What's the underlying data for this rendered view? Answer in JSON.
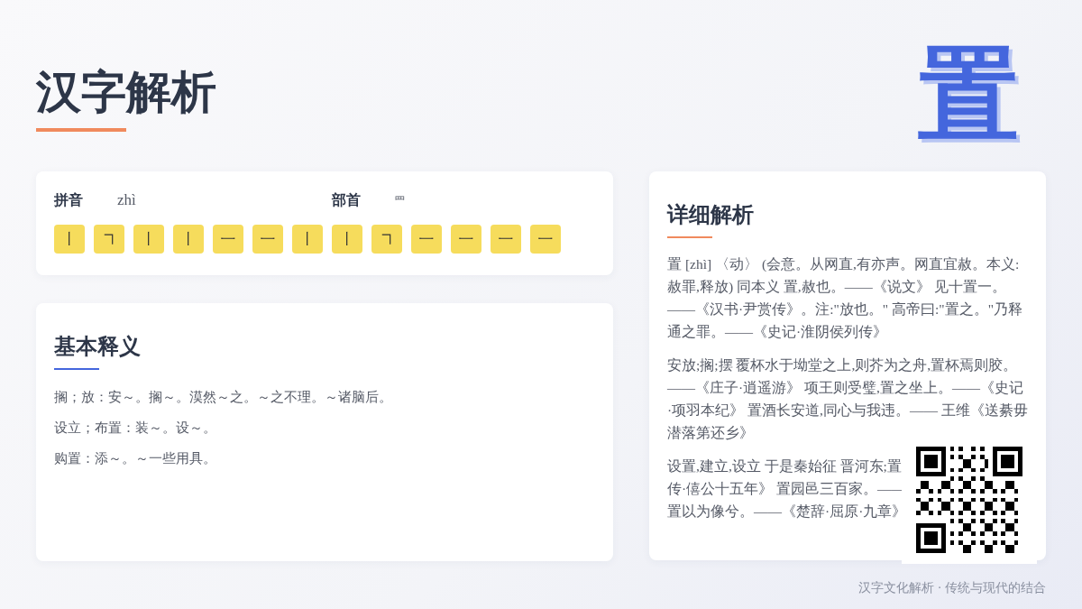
{
  "title": "汉字解析",
  "character": "置",
  "info": {
    "pinyin_label": "拼音",
    "pinyin": "zhì",
    "radical_label": "部首",
    "radical": "罒",
    "strokes": [
      "㇑",
      "㇕",
      "㇑",
      "㇑",
      "㇐",
      "㇐",
      "㇑",
      "㇑",
      "㇕",
      "㇐",
      "㇐",
      "㇐",
      "㇐"
    ]
  },
  "basic": {
    "heading": "基本释义",
    "items": [
      "搁；放：安～。搁～。漠然～之。～之不理。～诸脑后。",
      "设立；布置：装～。设～。",
      "购置：添～。～一些用具。"
    ]
  },
  "detail": {
    "heading": "详细解析",
    "paragraphs": [
      {
        "lines": [
          "置 [zhì] 〈动〉 (会意。从网直,有亦声。网直宜赦。本义:赦罪,释放) 同本义 置,赦也。——《说文》 见十置一。——《汉书·尹赏传》。注:\"放也。\" 高帝曰:\"置之。\"乃释通之罪。——《史记·淮阴侯列传》"
        ]
      },
      {
        "lines": [
          "安放;搁;摆 覆杯水于坳堂之上,则芥为之舟,置杯焉则胶。——《庄子·逍遥游》 项王则受璧,置之坐上。——《史记·项羽本纪》 置酒长安道,同心与我违。—— 王维《送綦毋潜落第还乡》"
        ]
      },
      {
        "lines": [
          "设置,建立,设立 于是秦始征 晋河东;置",
          "传·僖公十五年》 置园邑三百家。——",
          "置以为像兮。——《楚辞·屈原·九章》"
        ]
      }
    ]
  },
  "footer": "汉字文化解析 · 传统与现代的结合"
}
